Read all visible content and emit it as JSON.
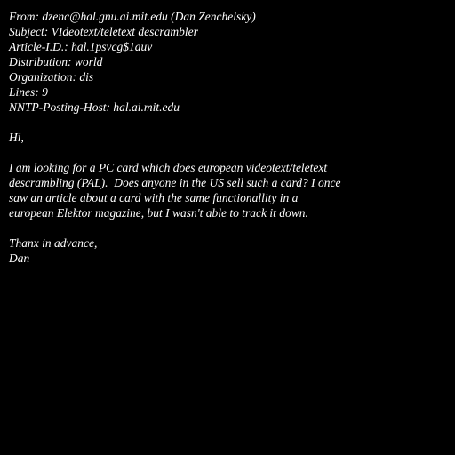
{
  "headers": {
    "from": "From: dzenc@hal.gnu.ai.mit.edu (Dan Zenchelsky)",
    "subject": "Subject: VIdeotext/teletext descrambler",
    "article_id": "Article-I.D.: hal.1psvcg$1auv",
    "distribution": "Distribution: world",
    "organization": "Organization: dis",
    "lines": "Lines: 9",
    "nntp_host": "NNTP-Posting-Host: hal.ai.mit.edu"
  },
  "body": {
    "greeting": "Hi,",
    "paragraph": [
      "I am looking for a PC card which does european videotext/teletext",
      "descrambling (PAL).  Does anyone in the US sell such a card? I once",
      "saw an article about a card with the same functionallity in a",
      "european Elektor magazine, but I wasn't able to track it down."
    ],
    "closing": "Thanx in advance,",
    "signature": "Dan"
  },
  "colors": {
    "background": "#000000",
    "text": "#ffffff"
  }
}
